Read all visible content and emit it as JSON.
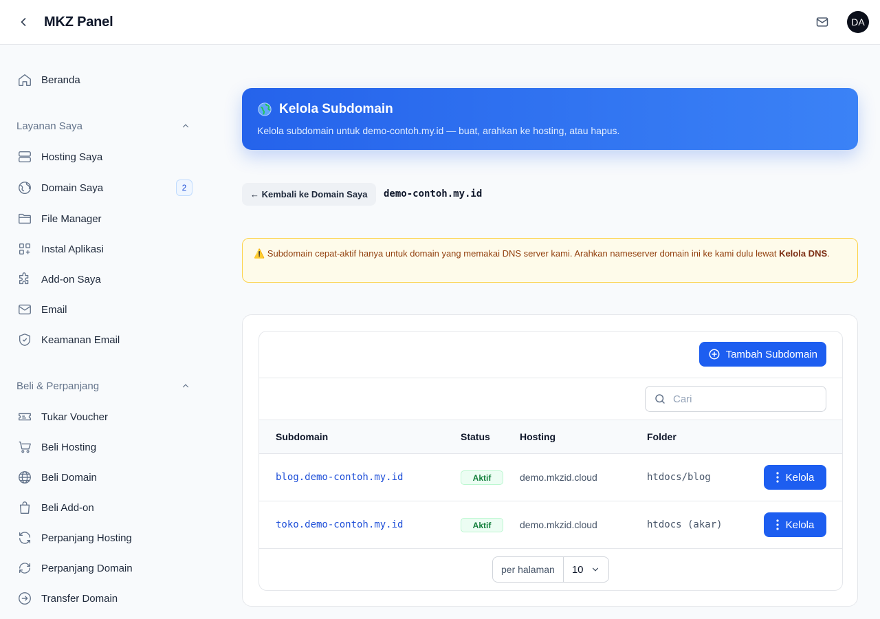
{
  "app": {
    "title": "MKZ Panel",
    "avatar_initials": "DA"
  },
  "icons": {
    "back": "chevron-left-icon",
    "mail": "mail-icon",
    "home": "home-icon",
    "server": "server-icon",
    "globe": "globe-icon",
    "folder": "folder-icon",
    "apps": "apps-plus-icon",
    "puzzle": "puzzle-icon",
    "shield": "shield-check-icon",
    "ticket": "ticket-icon",
    "cart": "cart-icon",
    "bag": "shopping-bag-icon",
    "refresh": "refresh-icon",
    "transfer": "arrow-circle-icon",
    "search": "search-icon",
    "plus": "plus-circle-icon",
    "dots": "vertical-dots-icon"
  },
  "sidebar": {
    "home_label": "Beranda",
    "group1": {
      "label": "Layanan Saya"
    },
    "group1_items": [
      {
        "label": "Hosting Saya"
      },
      {
        "label": "Domain Saya",
        "badge": "2"
      },
      {
        "label": "File Manager"
      },
      {
        "label": "Instal Aplikasi"
      },
      {
        "label": "Add-on Saya"
      },
      {
        "label": "Email"
      },
      {
        "label": "Keamanan Email"
      }
    ],
    "group2": {
      "label": "Beli & Perpanjang"
    },
    "group2_items": [
      {
        "label": "Tukar Voucher"
      },
      {
        "label": "Beli Hosting"
      },
      {
        "label": "Beli Domain"
      },
      {
        "label": "Beli Add-on"
      },
      {
        "label": "Perpanjang Hosting"
      },
      {
        "label": "Perpanjang Domain"
      },
      {
        "label": "Transfer Domain"
      }
    ]
  },
  "hero": {
    "title": "Kelola Subdomain",
    "subtitle": "Kelola subdomain untuk demo-contoh.my.id — buat, arahkan ke hosting, atau hapus."
  },
  "nav": {
    "back_label": "← Kembali ke Domain Saya",
    "domain": "demo-contoh.my.id"
  },
  "alert": {
    "text": "⚠️ Subdomain cepat-aktif hanya untuk domain yang memakai DNS server kami. Arahkan nameserver domain ini ke kami dulu lewat ",
    "link": "Kelola DNS",
    "suffix": "."
  },
  "table": {
    "add_button": "Tambah Subdomain",
    "search_placeholder": "Cari",
    "columns": {
      "subdomain": "Subdomain",
      "status": "Status",
      "hosting": "Hosting",
      "folder": "Folder"
    },
    "rows": [
      {
        "subdomain": "blog.demo-contoh.my.id",
        "status": "Aktif",
        "hosting": "demo.mkzid.cloud",
        "folder": "htdocs/blog",
        "action": "Kelola"
      },
      {
        "subdomain": "toko.demo-contoh.my.id",
        "status": "Aktif",
        "hosting": "demo.mkzid.cloud",
        "folder": "htdocs (akar)",
        "action": "Kelola"
      }
    ],
    "pager": {
      "label": "per halaman",
      "value": "10"
    }
  },
  "colors": {
    "primary": "#1d5ef0",
    "hero_start": "#2563eb",
    "hero_end": "#3b82f6",
    "alert_bg": "#fefbea",
    "status_green": "#15803d"
  }
}
